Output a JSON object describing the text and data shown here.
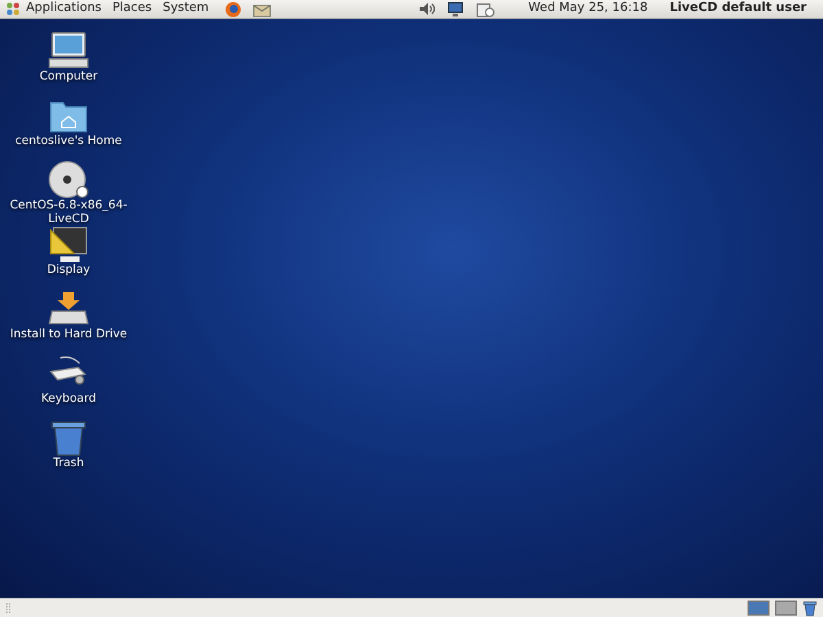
{
  "top_panel": {
    "menus": [
      "Applications",
      "Places",
      "System"
    ],
    "clock": "Wed May 25, 16:18",
    "user": "LiveCD default user"
  },
  "desktop_icons": [
    {
      "kind": "computer",
      "label": "Computer"
    },
    {
      "kind": "folder",
      "label": "centoslive's Home"
    },
    {
      "kind": "disc",
      "label": "CentOS-6.8-x86_64-LiveCD"
    },
    {
      "kind": "display",
      "label": "Display"
    },
    {
      "kind": "install",
      "label": "Install to Hard Drive"
    },
    {
      "kind": "keyboard",
      "label": "Keyboard"
    },
    {
      "kind": "trash",
      "label": "Trash"
    }
  ],
  "bottom_panel": {
    "workspaces": [
      {
        "selected": true
      },
      {
        "selected": false
      }
    ]
  }
}
